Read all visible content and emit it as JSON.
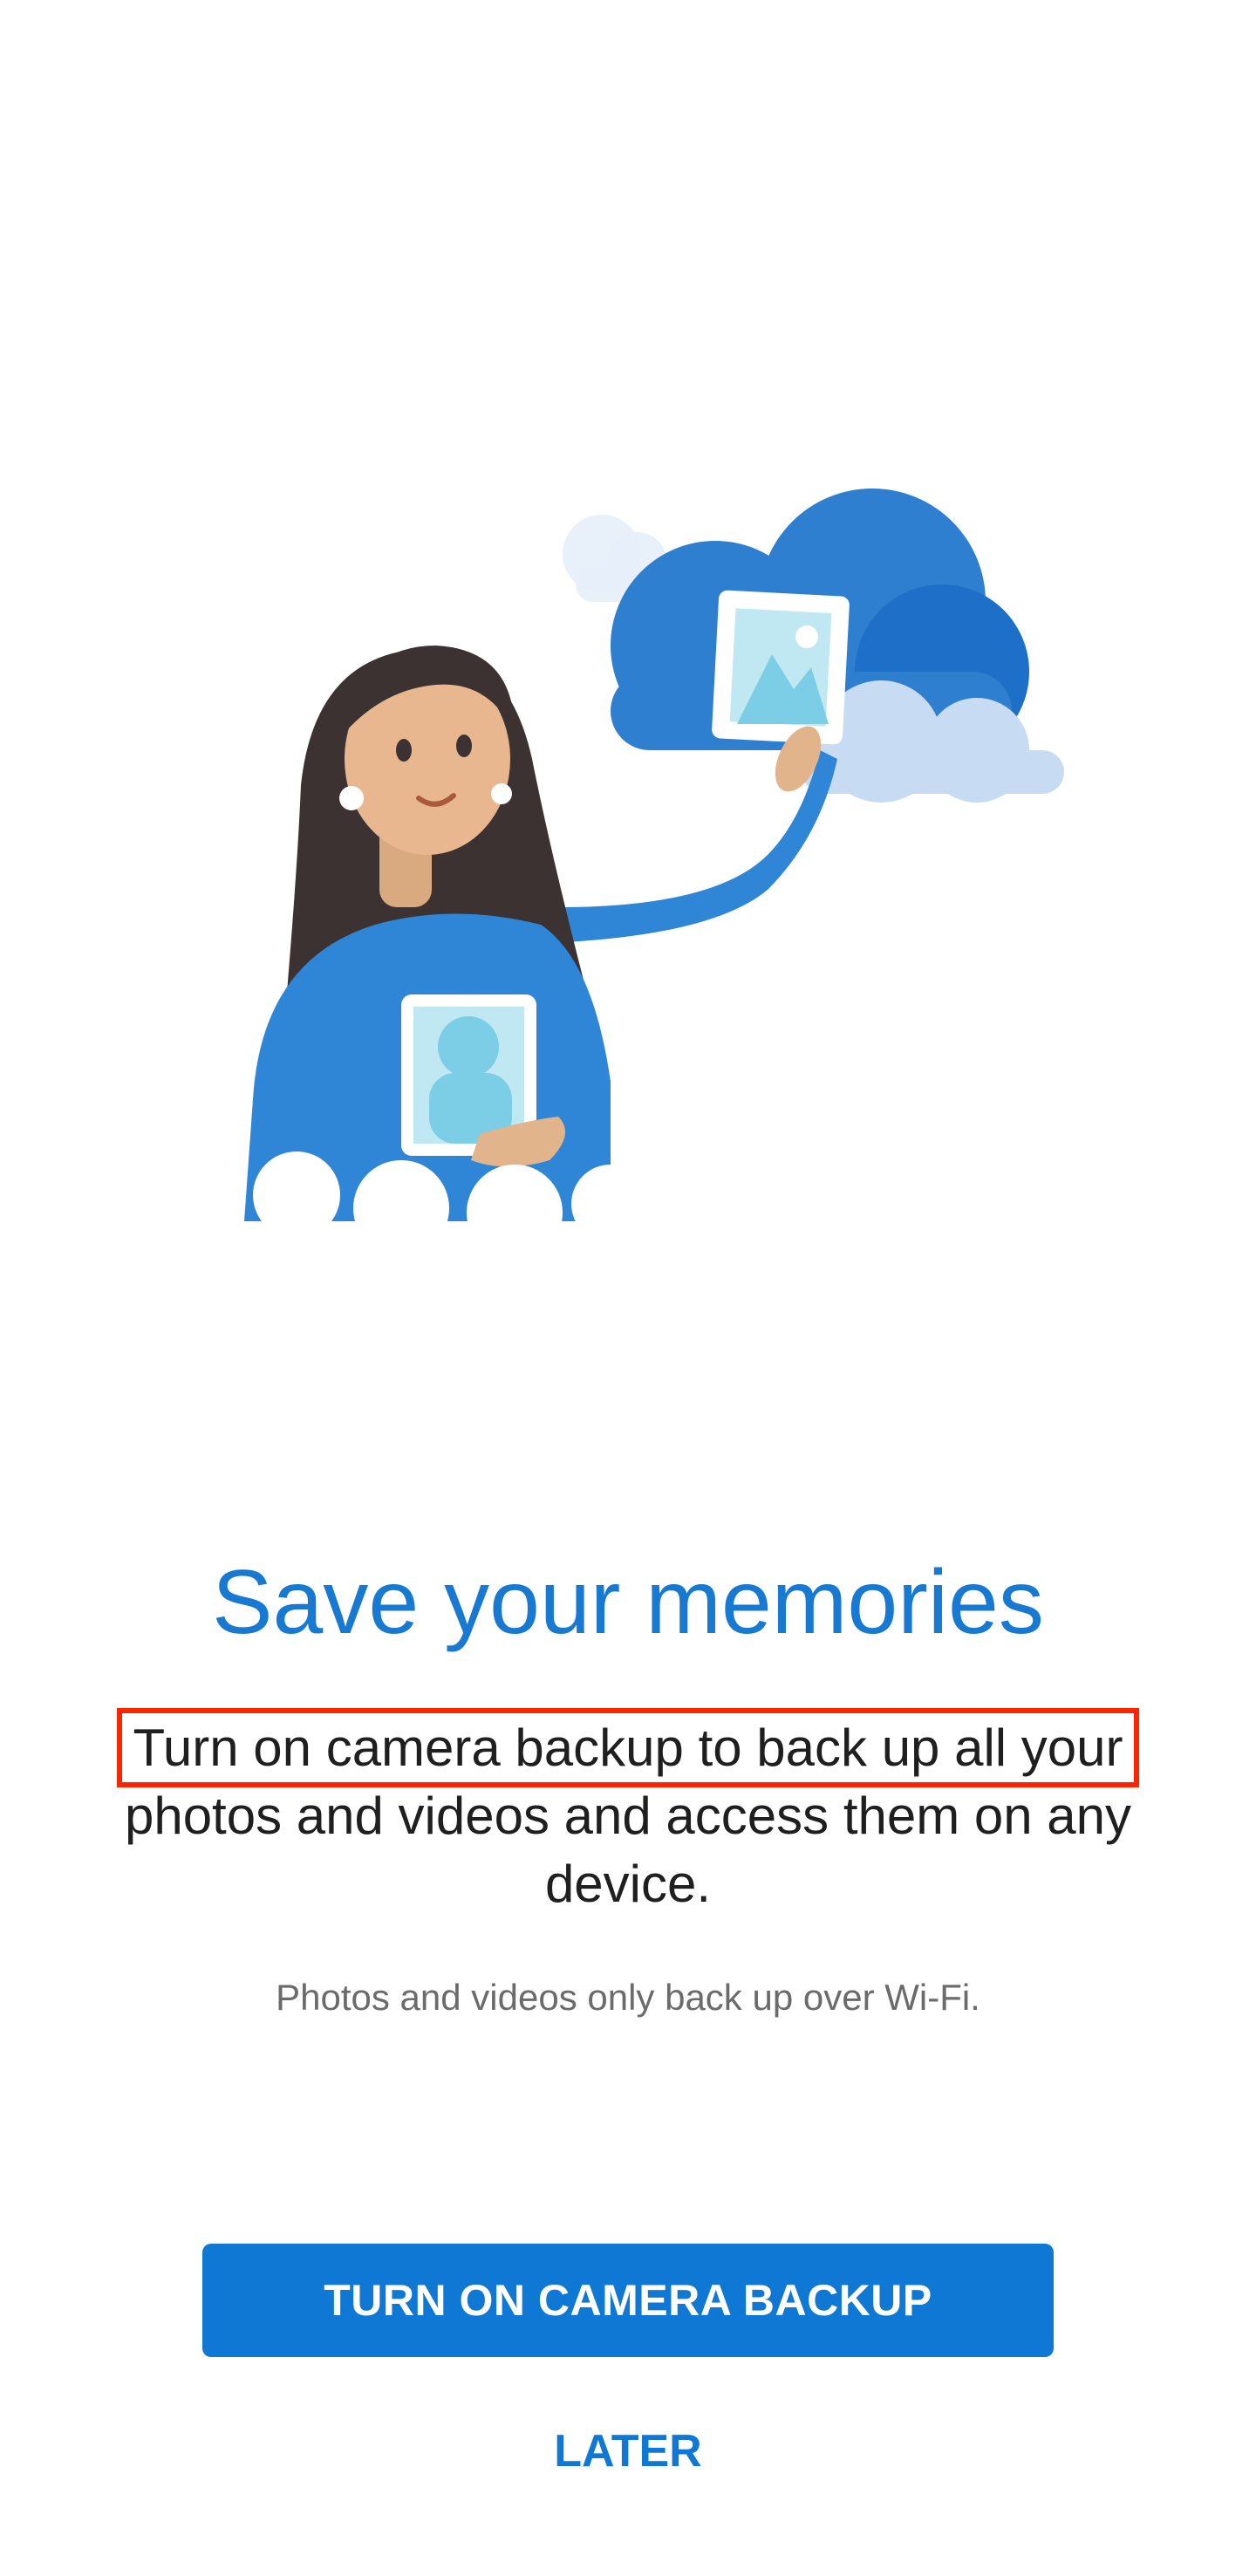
{
  "onboarding": {
    "title": "Save your memories",
    "body_highlight": "Turn on camera backup to back up all your",
    "body_rest": "photos and videos and access them on any device.",
    "note": "Photos and videos only back up over Wi-Fi.",
    "primary_button": "TURN ON CAMERA BACKUP",
    "secondary_button": "LATER"
  },
  "colors": {
    "accent": "#0f78d4",
    "title": "#1779d2",
    "highlight_outline": "#ff2400"
  },
  "icons": {
    "illustration": "woman-holding-photos-cloud-illustration"
  }
}
